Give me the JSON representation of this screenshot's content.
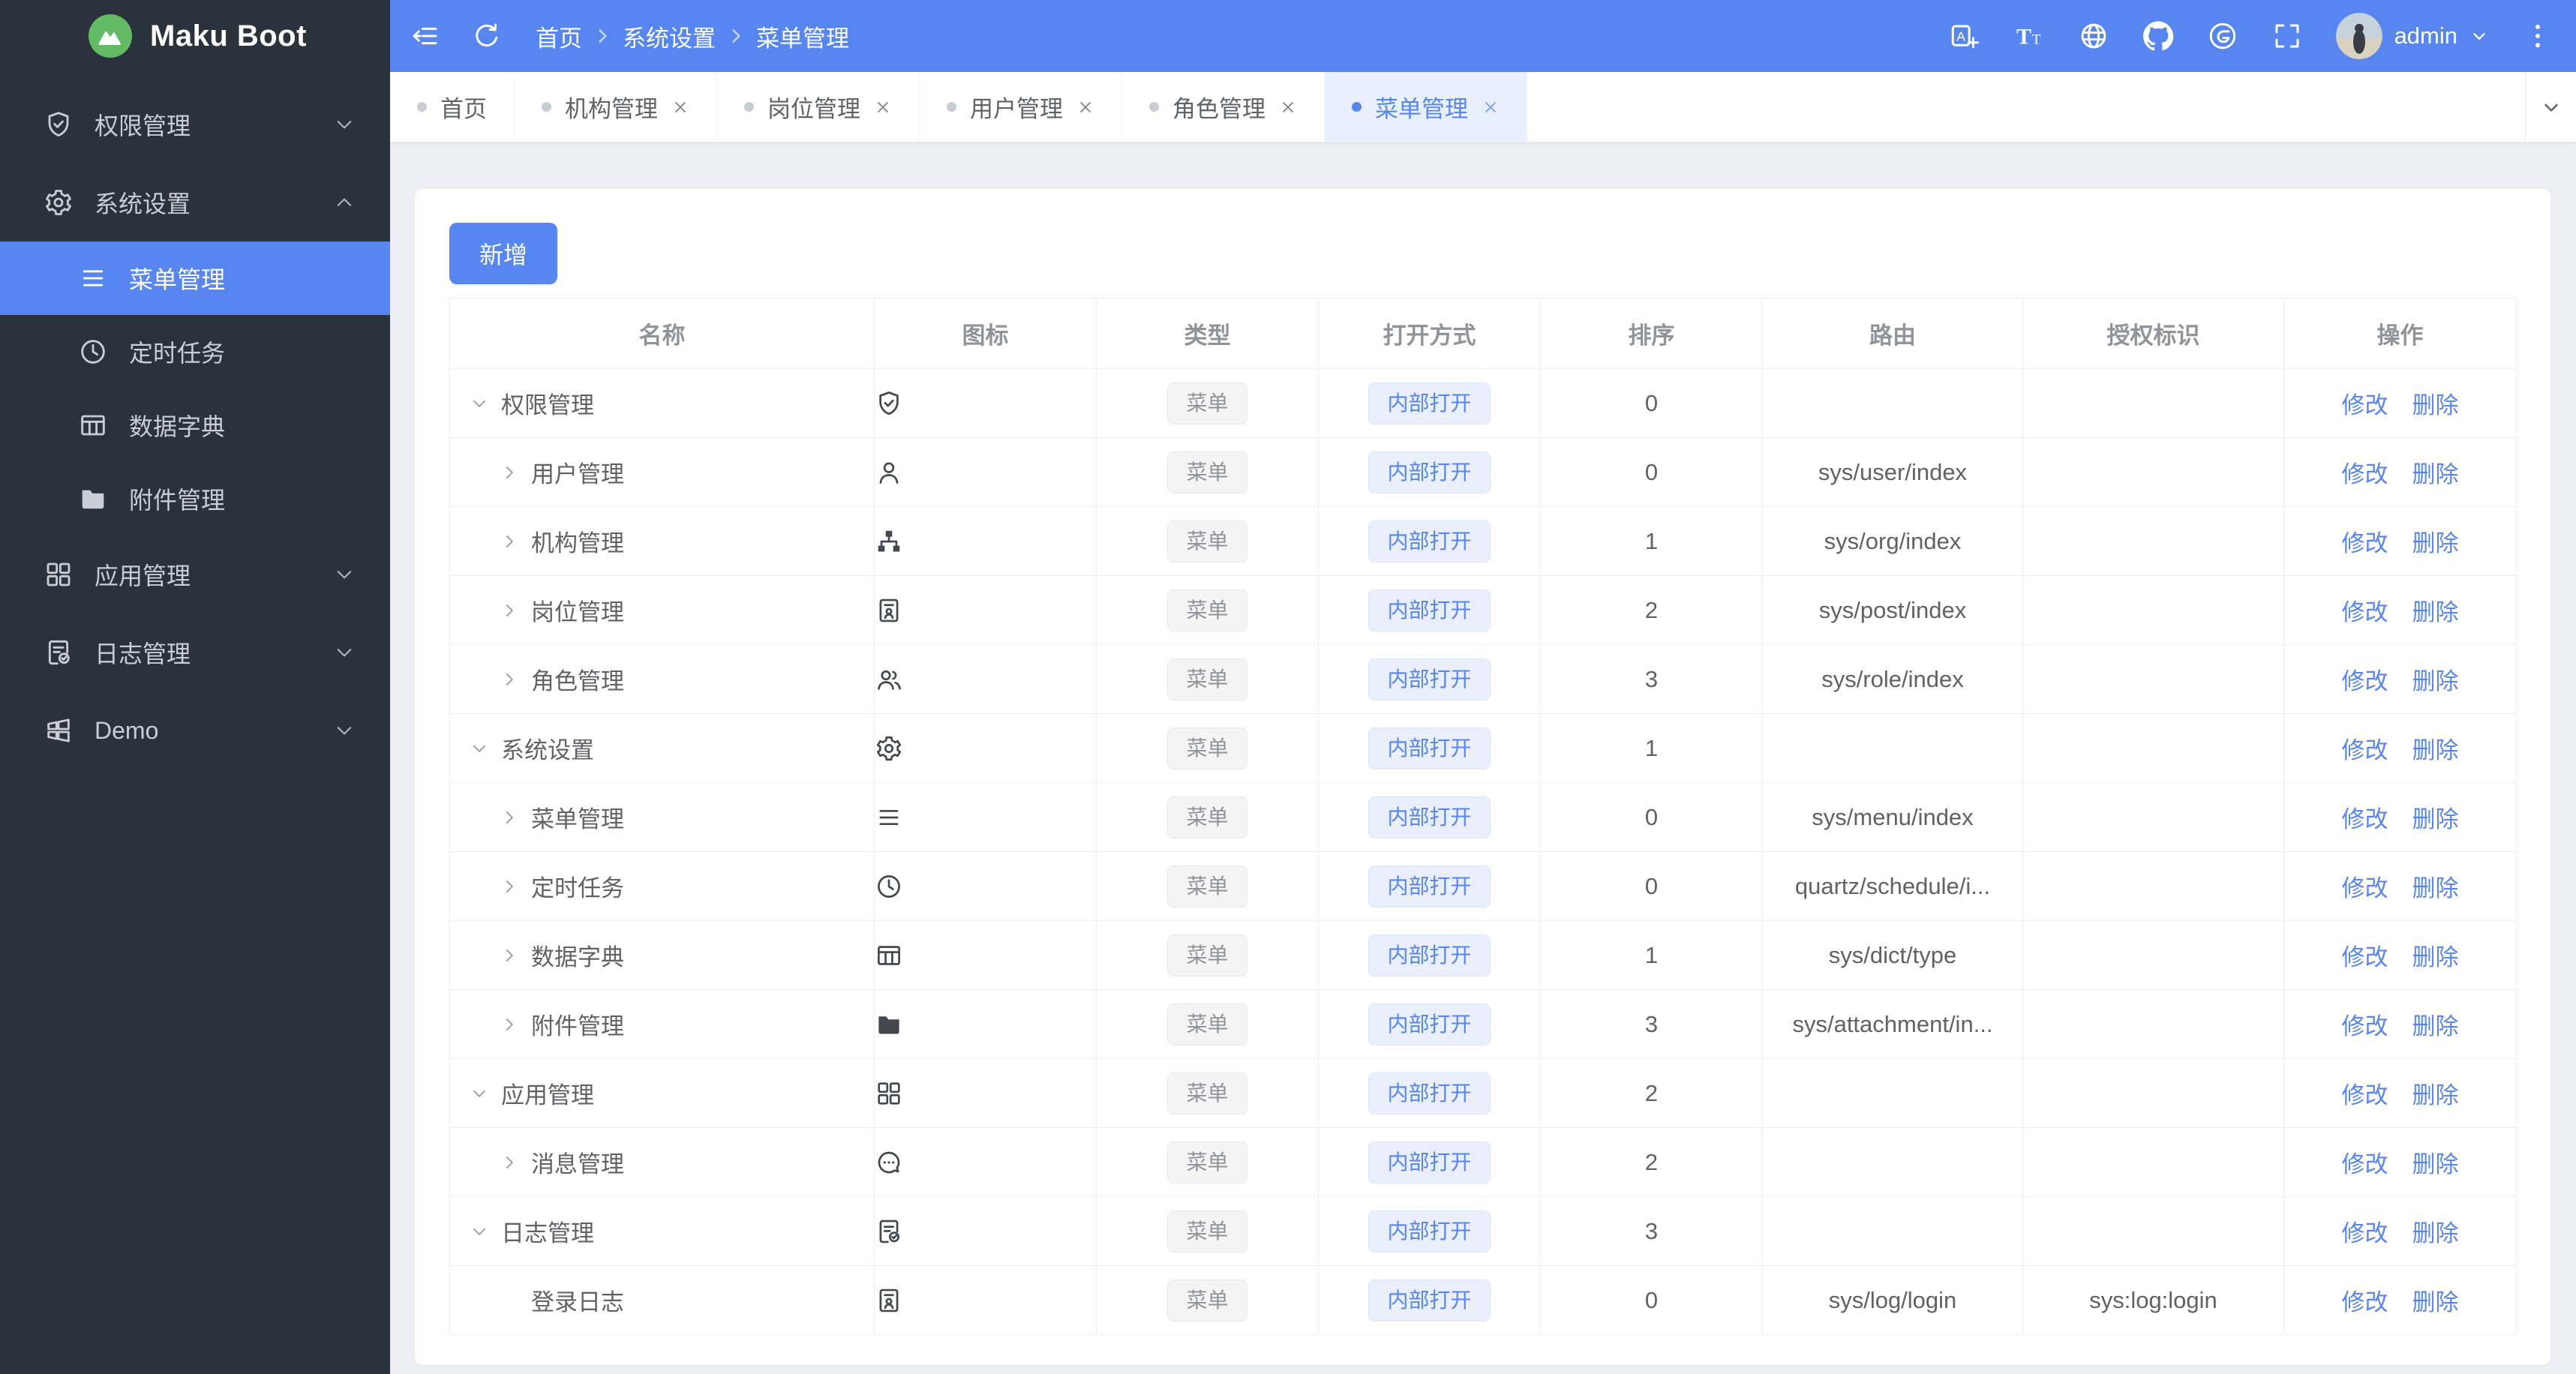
{
  "app": {
    "name": "Maku Boot"
  },
  "header": {
    "breadcrumb": [
      "首页",
      "系统设置",
      "菜单管理"
    ],
    "left_tools": [
      {
        "id": "collapse-sidebar",
        "icon": "fold"
      },
      {
        "id": "refresh",
        "icon": "refresh"
      }
    ],
    "right_tools": [
      {
        "id": "translate",
        "icon": "translate"
      },
      {
        "id": "font-size",
        "icon": "font-size"
      },
      {
        "id": "language-globe",
        "icon": "globe"
      },
      {
        "id": "github",
        "icon": "github"
      },
      {
        "id": "gitee",
        "icon": "gitee"
      },
      {
        "id": "fullscreen",
        "icon": "fullscreen"
      }
    ],
    "user": "admin",
    "more_icon": "more-dots"
  },
  "sidebar": {
    "items": [
      {
        "id": "permission",
        "label": "权限管理",
        "icon": "shield-check",
        "chevron": "down"
      },
      {
        "id": "system-settings",
        "label": "系统设置",
        "icon": "gear",
        "chevron": "up",
        "expanded": true,
        "children": [
          {
            "id": "menu-management",
            "label": "菜单管理",
            "icon": "menu-lines",
            "active": true
          },
          {
            "id": "scheduled-tasks",
            "label": "定时任务",
            "icon": "clock"
          },
          {
            "id": "data-dictionary",
            "label": "数据字典",
            "icon": "table-grid"
          },
          {
            "id": "attachment-management",
            "label": "附件管理",
            "icon": "folder"
          }
        ]
      },
      {
        "id": "app-management",
        "label": "应用管理",
        "icon": "grid-squares",
        "chevron": "down"
      },
      {
        "id": "log-management",
        "label": "日志管理",
        "icon": "doc-check",
        "chevron": "down"
      },
      {
        "id": "demo",
        "label": "Demo",
        "icon": "windows-grid",
        "chevron": "down"
      }
    ]
  },
  "tabs": [
    {
      "id": "home",
      "label": "首页",
      "closable": false,
      "active": false
    },
    {
      "id": "org",
      "label": "机构管理",
      "closable": true,
      "active": false
    },
    {
      "id": "post",
      "label": "岗位管理",
      "closable": true,
      "active": false
    },
    {
      "id": "user",
      "label": "用户管理",
      "closable": true,
      "active": false
    },
    {
      "id": "role",
      "label": "角色管理",
      "closable": true,
      "active": false
    },
    {
      "id": "menu",
      "label": "菜单管理",
      "closable": true,
      "active": true
    }
  ],
  "toolbar": {
    "add_label": "新增"
  },
  "table": {
    "columns": [
      "名称",
      "图标",
      "类型",
      "打开方式",
      "排序",
      "路由",
      "授权标识",
      "操作"
    ],
    "actions": [
      "修改",
      "删除"
    ],
    "rows": [
      {
        "name": "权限管理",
        "arrow": "expanded",
        "indent": 0,
        "icon": "shield-check",
        "type": "菜单",
        "open": "内部打开",
        "sort": "0",
        "route": "",
        "auth": ""
      },
      {
        "name": "用户管理",
        "arrow": "collapsed",
        "indent": 1,
        "icon": "user",
        "type": "菜单",
        "open": "内部打开",
        "sort": "0",
        "route": "sys/user/index",
        "auth": ""
      },
      {
        "name": "机构管理",
        "arrow": "collapsed",
        "indent": 1,
        "icon": "org-tree",
        "type": "菜单",
        "open": "内部打开",
        "sort": "1",
        "route": "sys/org/index",
        "auth": ""
      },
      {
        "name": "岗位管理",
        "arrow": "collapsed",
        "indent": 1,
        "icon": "id-badge",
        "type": "菜单",
        "open": "内部打开",
        "sort": "2",
        "route": "sys/post/index",
        "auth": ""
      },
      {
        "name": "角色管理",
        "arrow": "collapsed",
        "indent": 1,
        "icon": "user-group",
        "type": "菜单",
        "open": "内部打开",
        "sort": "3",
        "route": "sys/role/index",
        "auth": ""
      },
      {
        "name": "系统设置",
        "arrow": "expanded",
        "indent": 0,
        "icon": "gear",
        "type": "菜单",
        "open": "内部打开",
        "sort": "1",
        "route": "",
        "auth": ""
      },
      {
        "name": "菜单管理",
        "arrow": "collapsed",
        "indent": 1,
        "icon": "menu-lines",
        "type": "菜单",
        "open": "内部打开",
        "sort": "0",
        "route": "sys/menu/index",
        "auth": ""
      },
      {
        "name": "定时任务",
        "arrow": "collapsed",
        "indent": 1,
        "icon": "clock",
        "type": "菜单",
        "open": "内部打开",
        "sort": "0",
        "route": "quartz/schedule/i...",
        "auth": ""
      },
      {
        "name": "数据字典",
        "arrow": "collapsed",
        "indent": 1,
        "icon": "table-grid",
        "type": "菜单",
        "open": "内部打开",
        "sort": "1",
        "route": "sys/dict/type",
        "auth": ""
      },
      {
        "name": "附件管理",
        "arrow": "collapsed",
        "indent": 1,
        "icon": "folder",
        "type": "菜单",
        "open": "内部打开",
        "sort": "3",
        "route": "sys/attachment/in...",
        "auth": ""
      },
      {
        "name": "应用管理",
        "arrow": "expanded",
        "indent": 0,
        "icon": "grid-squares",
        "type": "菜单",
        "open": "内部打开",
        "sort": "2",
        "route": "",
        "auth": ""
      },
      {
        "name": "消息管理",
        "arrow": "collapsed",
        "indent": 1,
        "icon": "chat-dots",
        "type": "菜单",
        "open": "内部打开",
        "sort": "2",
        "route": "",
        "auth": ""
      },
      {
        "name": "日志管理",
        "arrow": "expanded",
        "indent": 0,
        "icon": "doc-check",
        "type": "菜单",
        "open": "内部打开",
        "sort": "3",
        "route": "",
        "auth": ""
      },
      {
        "name": "登录日志",
        "arrow": "none",
        "indent": 1,
        "icon": "id-badge",
        "type": "菜单",
        "open": "内部打开",
        "sort": "0",
        "route": "sys/log/login",
        "auth": "sys:log:login"
      }
    ]
  },
  "colors": {
    "accent": "#5786f0",
    "accent_soft": "#e9f0fd",
    "sidebar_bg": "#2a323c",
    "content_bg": "#edeff4",
    "logo_green": "#62ba62",
    "tag_gray_bg": "#f4f4f5",
    "tag_blue_bg": "#e9effc",
    "table_border": "#ebeef5"
  }
}
